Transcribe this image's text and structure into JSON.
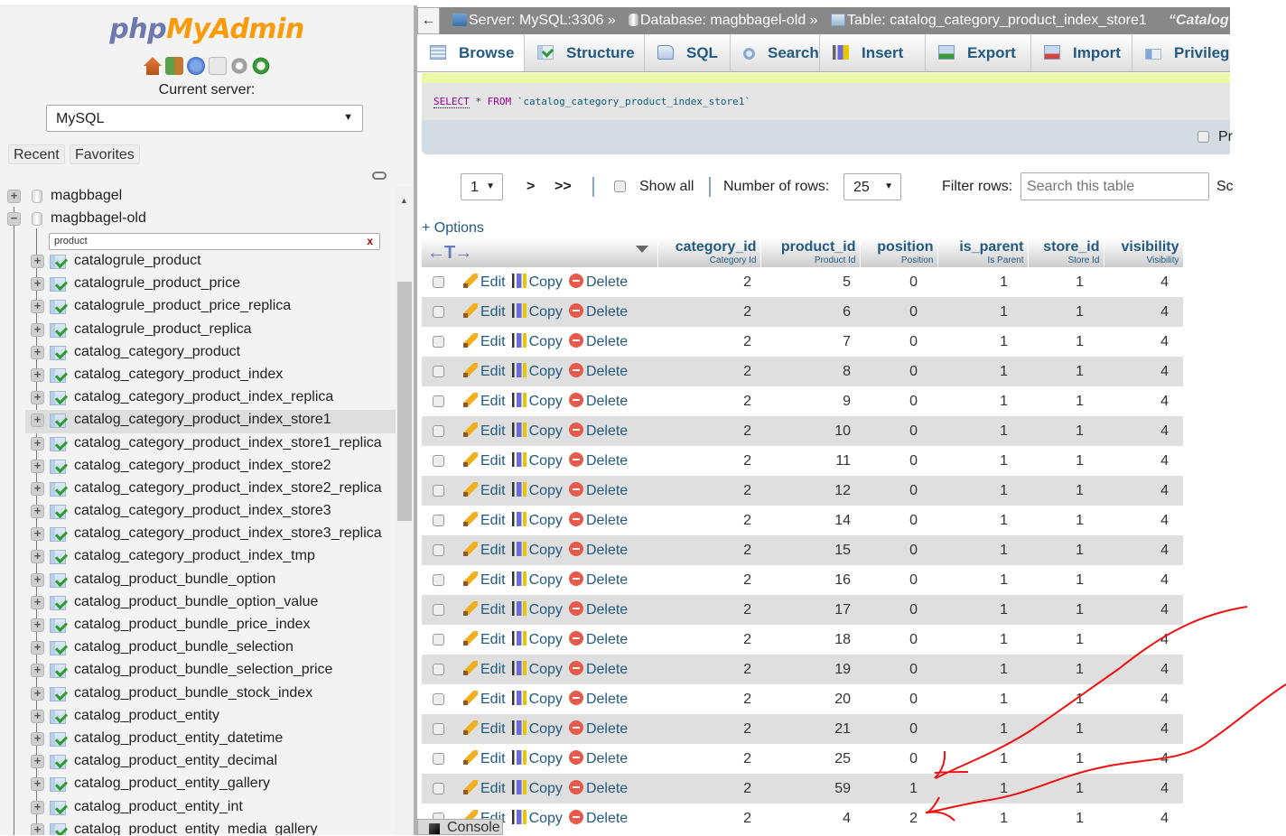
{
  "nav": {
    "logo_php": "php",
    "logo_myadmin": "MyAdmin",
    "icons": [
      "home-icon",
      "logout-icon",
      "help-icon",
      "documentation-icon",
      "settings-icon",
      "reload-icon"
    ],
    "current_server_label": "Current server:",
    "server_select_value": "MySQL",
    "recent_label": "Recent",
    "favorites_label": "Favorites",
    "databases": [
      {
        "name": "magbbagel",
        "expanded": false
      },
      {
        "name": "magbbagel-old",
        "expanded": true
      }
    ],
    "table_filter_value": "product",
    "table_filter_clear": "x",
    "tables": [
      "catalogrule_product",
      "catalogrule_product_price",
      "catalogrule_product_price_replica",
      "catalogrule_product_replica",
      "catalog_category_product",
      "catalog_category_product_index",
      "catalog_category_product_index_replica",
      "catalog_category_product_index_store1",
      "catalog_category_product_index_store1_replica",
      "catalog_category_product_index_store2",
      "catalog_category_product_index_store2_replica",
      "catalog_category_product_index_store3",
      "catalog_category_product_index_store3_replica",
      "catalog_category_product_index_tmp",
      "catalog_product_bundle_option",
      "catalog_product_bundle_option_value",
      "catalog_product_bundle_price_index",
      "catalog_product_bundle_selection",
      "catalog_product_bundle_selection_price",
      "catalog_product_bundle_stock_index",
      "catalog_product_entity",
      "catalog_product_entity_datetime",
      "catalog_product_entity_decimal",
      "catalog_product_entity_gallery",
      "catalog_product_entity_int",
      "catalog_product_entity_media_gallery"
    ],
    "selected_table": "catalog_category_product_index_store1"
  },
  "breadcrumb": {
    "back": "←",
    "server": "Server: MySQL:3306 »",
    "database": "Database: magbbagel-old »",
    "table": "Table: catalog_category_product_index_store1",
    "comment": "“Catalog"
  },
  "tabs": [
    {
      "label": "Browse",
      "icon": "browse-icon",
      "active": true
    },
    {
      "label": "Structure",
      "icon": "structure-icon"
    },
    {
      "label": "SQL",
      "icon": "sql-icon"
    },
    {
      "label": "Search",
      "icon": "search-icon"
    },
    {
      "label": "Insert",
      "icon": "insert-icon"
    },
    {
      "label": "Export",
      "icon": "export-icon"
    },
    {
      "label": "Import",
      "icon": "import-icon"
    },
    {
      "label": "Privilege",
      "icon": "privileges-icon"
    }
  ],
  "query": {
    "select": "SELECT",
    "star": " * ",
    "from": "FROM",
    "table": " `catalog_category_product_index_store1`",
    "profiling_label": "Pr"
  },
  "pager": {
    "page_value": "1",
    "next": ">",
    "last": ">>",
    "show_all_label": "Show all",
    "rows_label": "Number of rows:",
    "rows_value": "25",
    "filter_label": "Filter rows:",
    "filter_placeholder": "Search this table",
    "sort_label": "Sc"
  },
  "options_label": "+ Options",
  "table": {
    "columns": [
      {
        "name": "category_id",
        "comment": "Category Id"
      },
      {
        "name": "product_id",
        "comment": "Product Id"
      },
      {
        "name": "position",
        "comment": "Position"
      },
      {
        "name": "is_parent",
        "comment": "Is Parent"
      },
      {
        "name": "store_id",
        "comment": "Store Id"
      },
      {
        "name": "visibility",
        "comment": "Visibility"
      }
    ],
    "actions": {
      "edit": "Edit",
      "copy": "Copy",
      "delete": "Delete"
    },
    "rows": [
      [
        2,
        5,
        0,
        1,
        1,
        4
      ],
      [
        2,
        6,
        0,
        1,
        1,
        4
      ],
      [
        2,
        7,
        0,
        1,
        1,
        4
      ],
      [
        2,
        8,
        0,
        1,
        1,
        4
      ],
      [
        2,
        9,
        0,
        1,
        1,
        4
      ],
      [
        2,
        10,
        0,
        1,
        1,
        4
      ],
      [
        2,
        11,
        0,
        1,
        1,
        4
      ],
      [
        2,
        12,
        0,
        1,
        1,
        4
      ],
      [
        2,
        14,
        0,
        1,
        1,
        4
      ],
      [
        2,
        15,
        0,
        1,
        1,
        4
      ],
      [
        2,
        16,
        0,
        1,
        1,
        4
      ],
      [
        2,
        17,
        0,
        1,
        1,
        4
      ],
      [
        2,
        18,
        0,
        1,
        1,
        4
      ],
      [
        2,
        19,
        0,
        1,
        1,
        4
      ],
      [
        2,
        20,
        0,
        1,
        1,
        4
      ],
      [
        2,
        21,
        0,
        1,
        1,
        4
      ],
      [
        2,
        25,
        0,
        1,
        1,
        4
      ],
      [
        2,
        59,
        1,
        1,
        1,
        4
      ],
      [
        2,
        4,
        2,
        1,
        1,
        4
      ]
    ]
  },
  "console_label": "Console",
  "annotation_color": "#ee1111"
}
